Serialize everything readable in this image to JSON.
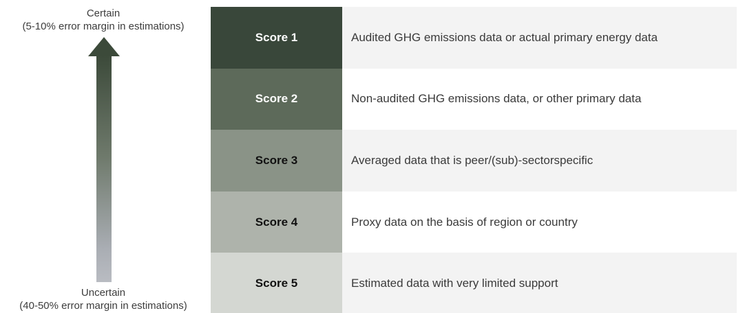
{
  "arrow": {
    "top_title": "Certain",
    "top_subtitle": "(5-10% error margin in estimations)",
    "bottom_title": "Uncertain",
    "bottom_subtitle": "(40-50% error margin in estimations)"
  },
  "rows": [
    {
      "score": "Score 1",
      "description": "Audited GHG emissions data or actual primary energy data"
    },
    {
      "score": "Score 2",
      "description": "Non-audited GHG emissions data, or other primary data"
    },
    {
      "score": "Score 3",
      "description": "Averaged data that is peer/(sub)-sectorspecific"
    },
    {
      "score": "Score 4",
      "description": "Proxy data on the basis of region or country"
    },
    {
      "score": "Score 5",
      "description": "Estimated data with very limited support"
    }
  ],
  "colors": {
    "score1": "#39473a",
    "score2": "#5d6a5a",
    "score3": "#8a9387",
    "score4": "#aeb3ab",
    "score5": "#d4d7d2"
  }
}
